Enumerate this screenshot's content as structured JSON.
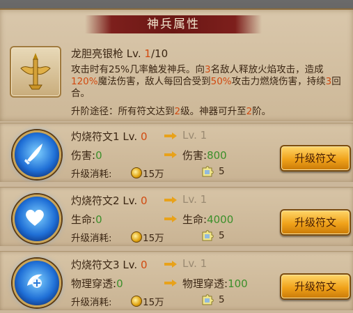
{
  "panel": {
    "title": "神兵属性",
    "weapon_name": "龙胆亮银枪",
    "level_prefix": "Lv.",
    "level_current": "1",
    "level_max": "/10",
    "desc": [
      {
        "t": "攻击时有25%几率触发神兵。向"
      },
      {
        "t": "3",
        "h": true
      },
      {
        "t": "名敌人释放火焰攻击，造成"
      },
      {
        "t": "120%",
        "h": true
      },
      {
        "t": "魔法伤害，敌人每回合受到"
      },
      {
        "t": "50%",
        "h": true
      },
      {
        "t": "攻击力燃烧伤害，持续"
      },
      {
        "t": "3",
        "h": true
      },
      {
        "t": "回合。"
      }
    ],
    "upgrade_path": [
      {
        "t": "升阶途径：所有符文达到"
      },
      {
        "t": "2",
        "h": true
      },
      {
        "t": "级。神器可升至"
      },
      {
        "t": "2",
        "h": true
      },
      {
        "t": "阶。"
      }
    ]
  },
  "runes": [
    {
      "icon": "blade-icon",
      "name": "灼烧符文1",
      "lv_label": "Lv.",
      "lv_from": "0",
      "lv_to": "Lv. 1",
      "stat_label": "伤害",
      "stat_value": "0",
      "next_label": "伤害",
      "next_value": "800",
      "cost_label": "升级消耗:",
      "coin_amount": "15万",
      "shard_amount": "5",
      "button": "升级符文"
    },
    {
      "icon": "heart-icon",
      "name": "灼烧符文2",
      "lv_label": "Lv.",
      "lv_from": "0",
      "lv_to": "Lv. 1",
      "stat_label": "生命",
      "stat_value": "0",
      "next_label": "生命",
      "next_value": "4000",
      "cost_label": "升级消耗:",
      "coin_amount": "15万",
      "shard_amount": "5",
      "button": "升级符文"
    },
    {
      "icon": "pierce-icon",
      "name": "灼烧符文3",
      "lv_label": "Lv.",
      "lv_from": "0",
      "lv_to": "Lv. 1",
      "stat_label": "物理穿透",
      "stat_value": "0",
      "next_label": "物理穿透",
      "next_value": "100",
      "cost_label": "升级消耗:",
      "coin_amount": "15万",
      "shard_amount": "5",
      "button": "升级符文"
    }
  ],
  "colors": {
    "highlight": "#d14a10",
    "green": "#3b8f2a",
    "banner": "#6a1714",
    "button": "#f0a21a"
  }
}
